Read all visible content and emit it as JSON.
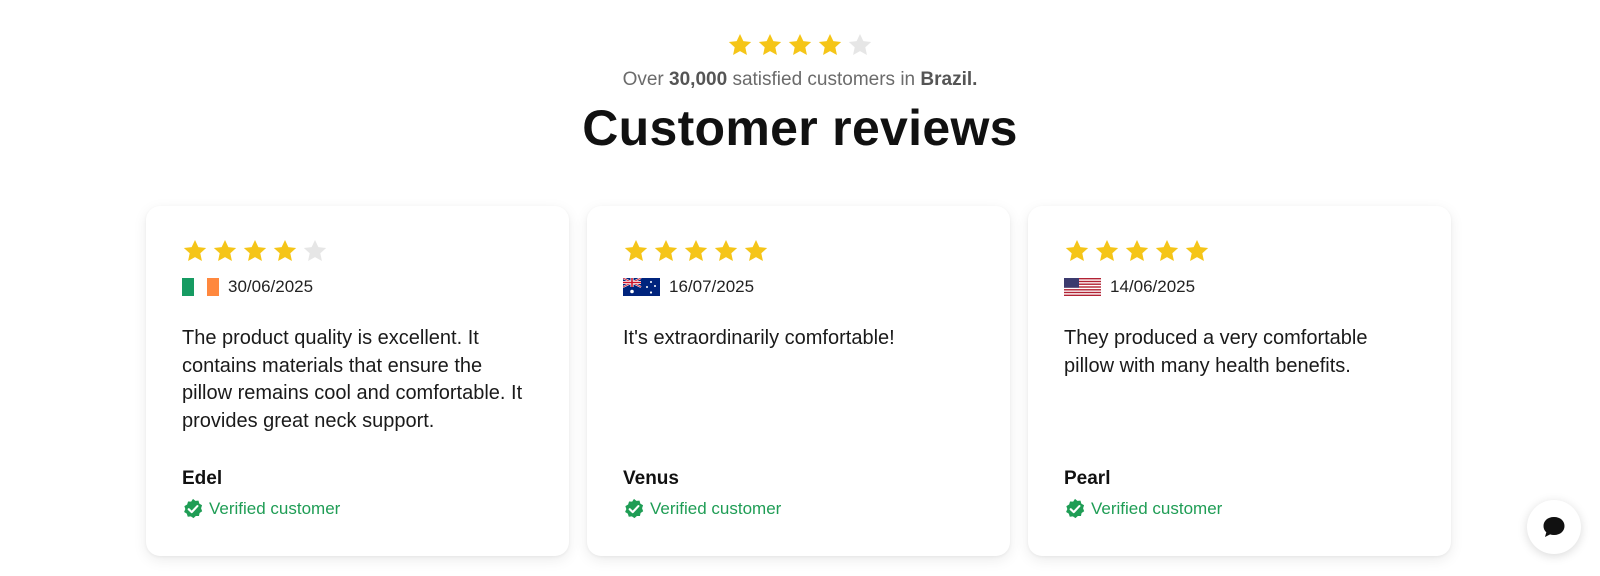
{
  "header": {
    "rating": 4,
    "max_rating": 5,
    "subtitle_prefix": "Over",
    "subtitle_count": "30,000",
    "subtitle_middle": "satisfied customers in",
    "subtitle_country": "Brazil.",
    "title": "Customer reviews"
  },
  "colors": {
    "star_filled": "#F5C518",
    "star_empty": "#E6E6E6",
    "verified": "#1F9D55"
  },
  "reviews": [
    {
      "rating": 4,
      "flag": "ireland-flag-icon",
      "date": "30/06/2025",
      "text": "The product quality is excellent. It contains materials that ensure the pillow remains cool and comfortable. It provides great neck support.",
      "name": "Edel",
      "verified_label": "Verified customer"
    },
    {
      "rating": 5,
      "flag": "australia-flag-icon",
      "date": "16/07/2025",
      "text": "It's extraordinarily comfortable!",
      "name": "Venus",
      "verified_label": "Verified customer"
    },
    {
      "rating": 5,
      "flag": "usa-flag-icon",
      "date": "14/06/2025",
      "text": "They produced a very comfortable pillow with many health benefits.",
      "name": "Pearl",
      "verified_label": "Verified customer"
    }
  ],
  "chat": {
    "icon": "chat-bubble-icon"
  }
}
